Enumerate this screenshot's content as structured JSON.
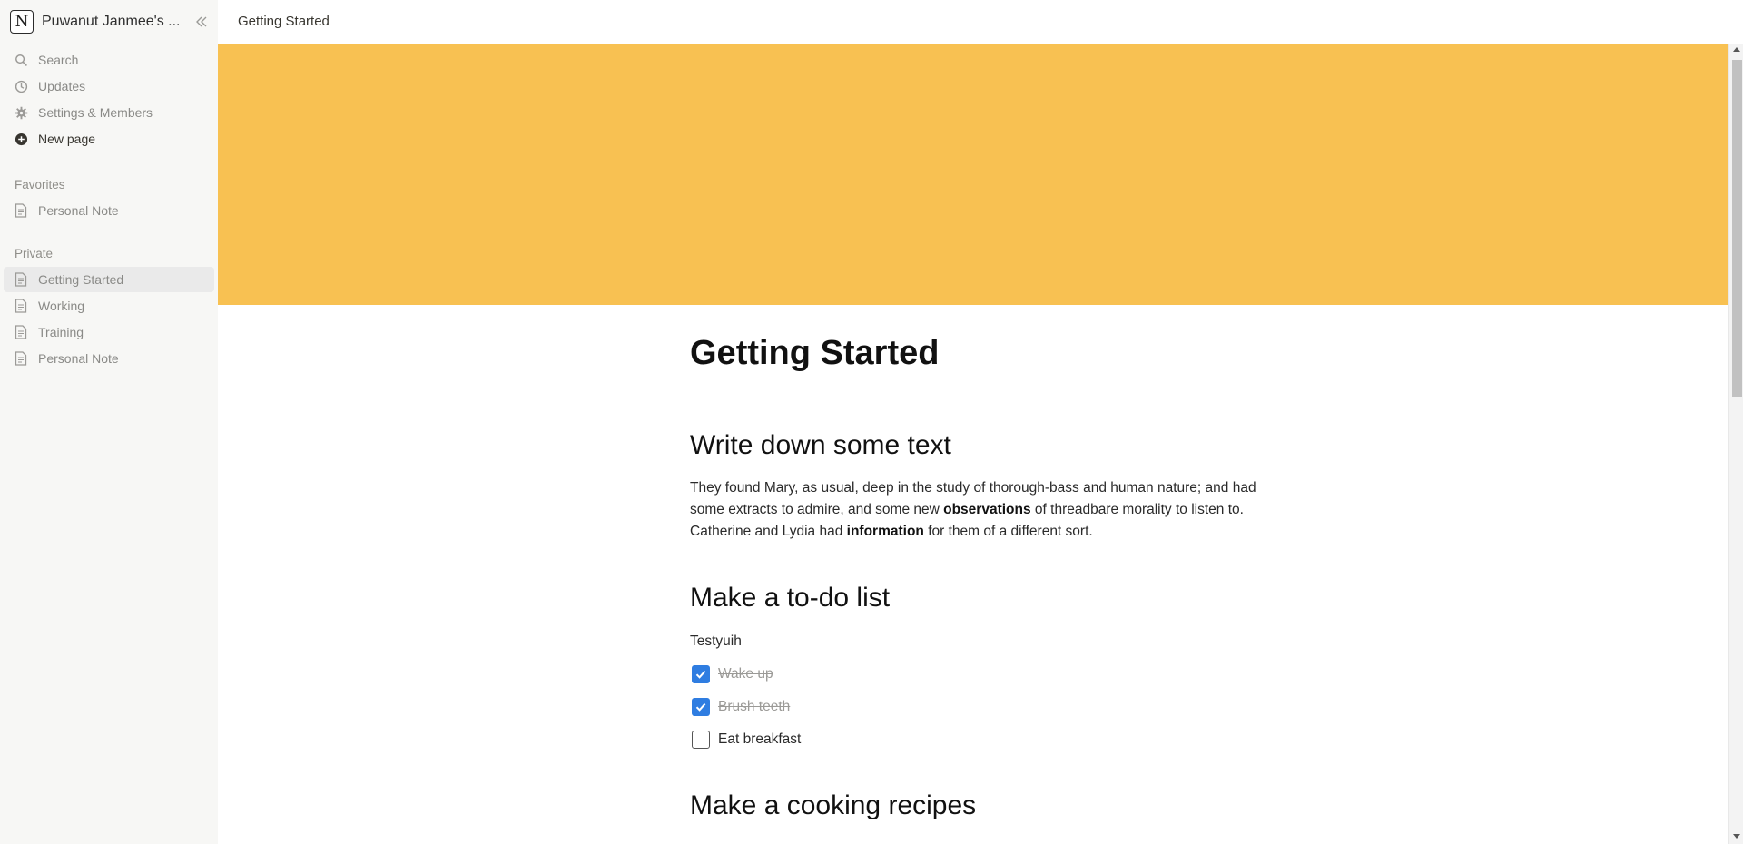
{
  "workspace": {
    "logo_letter": "N",
    "name": "Puwanut Janmee's ..."
  },
  "sidebar": {
    "top_items": [
      {
        "label": "Search",
        "icon": "search-icon"
      },
      {
        "label": "Updates",
        "icon": "clock-icon"
      },
      {
        "label": "Settings & Members",
        "icon": "gear-icon"
      },
      {
        "label": "New page",
        "icon": "plus-circle-icon"
      }
    ],
    "favorites_label": "Favorites",
    "favorites": [
      {
        "label": "Personal Note",
        "icon": "page-icon"
      }
    ],
    "private_label": "Private",
    "private": [
      {
        "label": "Getting Started",
        "icon": "page-icon",
        "active": true
      },
      {
        "label": "Working",
        "icon": "page-icon"
      },
      {
        "label": "Training",
        "icon": "page-icon"
      },
      {
        "label": "Personal Note",
        "icon": "page-icon"
      }
    ]
  },
  "topbar": {
    "breadcrumb": "Getting Started"
  },
  "cover": {
    "color": "#f8c152"
  },
  "page": {
    "title": "Getting Started",
    "section1": {
      "heading": "Write down some text",
      "p_part1": "They found Mary, as usual, deep in the study of thorough-bass and human nature; and had some extracts to admire, and some new ",
      "p_bold1": "observations",
      "p_part2": " of threadbare morality to listen to. Catherine and Lydia had ",
      "p_bold2": "information",
      "p_part3": " for them of a different sort."
    },
    "section2": {
      "heading": "Make a to-do list",
      "line": "Testyuih",
      "todos": [
        {
          "text": "Wake up",
          "checked": true
        },
        {
          "text": "Brush teeth",
          "checked": true
        },
        {
          "text": "Eat breakfast",
          "checked": false
        }
      ]
    },
    "section3": {
      "heading": "Make a cooking recipes"
    }
  },
  "colors": {
    "accent_checkbox": "#2f7de1",
    "sidebar_bg": "#f7f7f5"
  }
}
